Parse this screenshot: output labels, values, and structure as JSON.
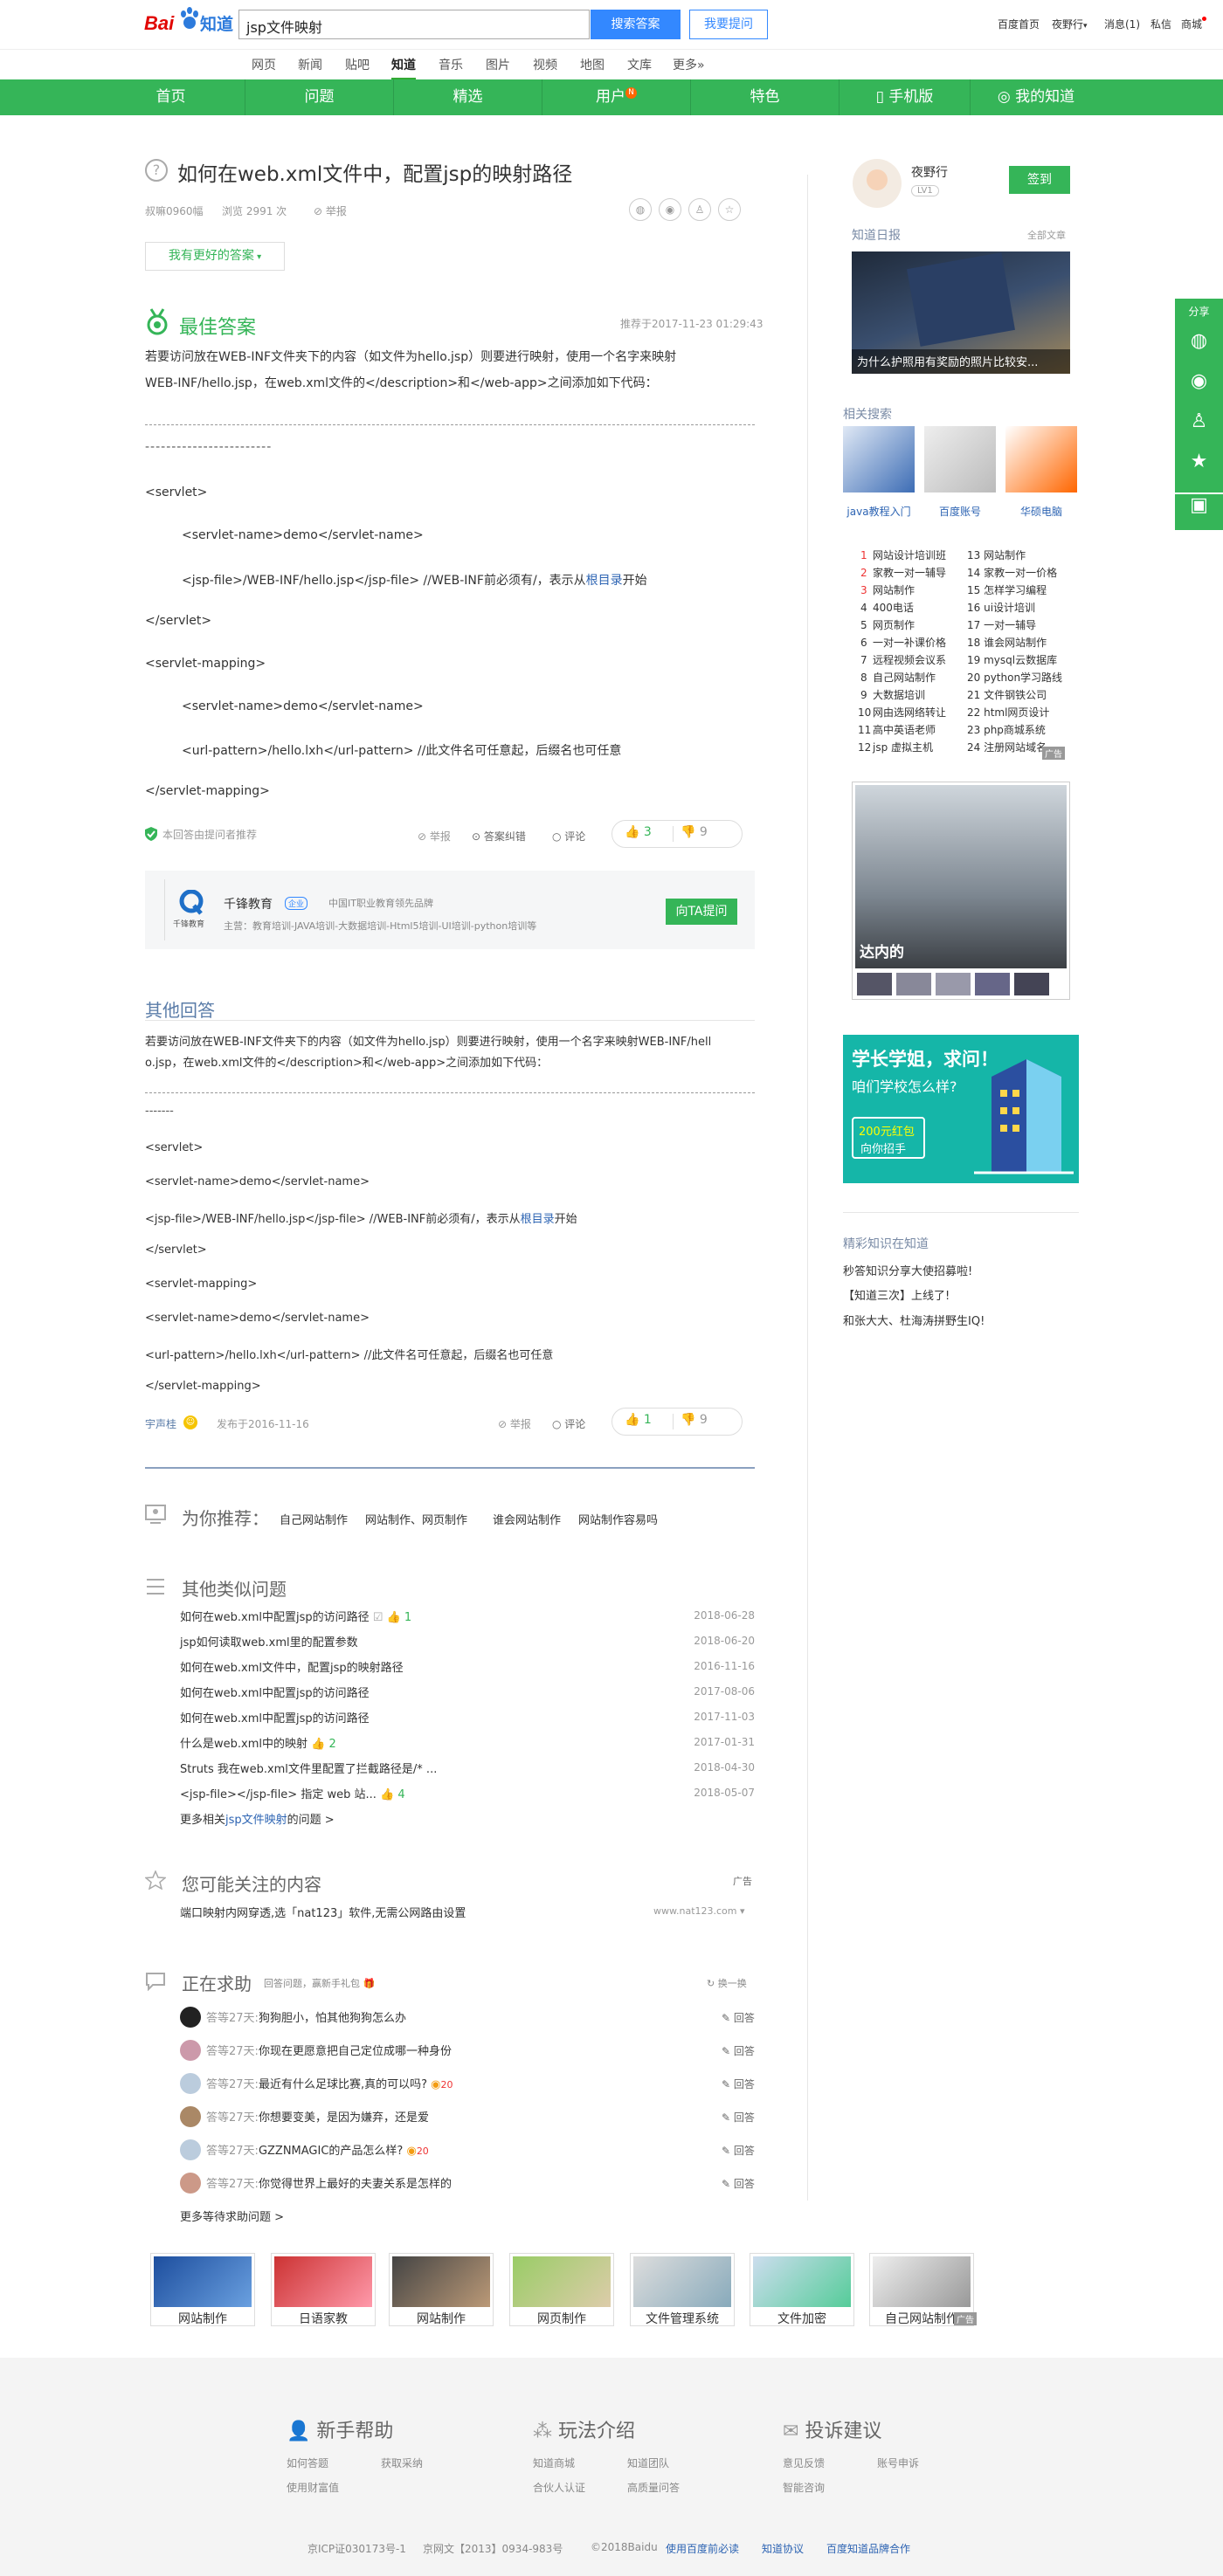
{
  "header": {
    "logo_text_a": "Bai",
    "logo_text_b": "知道",
    "search_value": "jsp文件映射",
    "search_button": "搜索答案",
    "ask_button": "我要提问",
    "user_links": [
      "百度首页",
      "夜野行",
      "消息(1)",
      "私信",
      "商城"
    ]
  },
  "nav": {
    "items": [
      "网页",
      "新闻",
      "贴吧",
      "知道",
      "音乐",
      "图片",
      "视频",
      "地图",
      "文库",
      "更多»"
    ],
    "current": "知道"
  },
  "green_bar": {
    "items": [
      "首页",
      "问题",
      "精选",
      "用户",
      "特色",
      "手机版",
      "我的知道"
    ],
    "badge": "N"
  },
  "question": {
    "title": "如何在web.xml文件中，配置jsp的映射路径",
    "asker": "叔嘛0960幅",
    "views": "浏览 2991 次",
    "report": "举报",
    "better_answer_button": "我有更好的答案"
  },
  "best_answer": {
    "heading": "最佳答案",
    "time": "推荐于2017-11-23 01:29:43",
    "intro1": "若要访问放在WEB-INF文件夹下的内容（如文件为hello.jsp）则要进行映射，使用一个名字来映射",
    "intro2": "WEB-INF/hello.jsp，在web.xml文件的</description>和</web-app>之间添加如下代码：",
    "dash_tail": "------------------------",
    "code": [
      "<servlet>",
      "<servlet-name>demo</servlet-name>",
      "<jsp-file>/WEB-INF/hello.jsp</jsp-file>   //WEB-INF前必须有/，表示从",
      "</servlet>",
      "<servlet-mapping>",
      "<servlet-name>demo</servlet-name>",
      "<url-pattern>/hello.lxh</url-pattern>           //此文件名可任意起，后缀名也可任意",
      "</servlet-mapping>"
    ],
    "root_link": "根目录",
    "root_tail": "开始",
    "recommended_by": "本回答由提问者推荐",
    "report": "举报",
    "correction": "答案纠错",
    "comment": "评论",
    "up": "3",
    "down": "9"
  },
  "company": {
    "name": "千锋教育",
    "tag": "企业",
    "desc": "中国IT职业教育领先品牌",
    "main": "主营：教育培训-JAVA培训-大数据培训-Html5培训-UI培训-python培训等",
    "button": "向TA提问",
    "logo_text": "千锋教育"
  },
  "other_answer": {
    "heading": "其他回答",
    "intro1": "若要访问放在WEB-INF文件夹下的内容（如文件为hello.jsp）则要进行映射，使用一个名字来映射WEB-INF/hell",
    "intro2": "o.jsp，在web.xml文件的</description>和</web-app>之间添加如下代码：",
    "dash_tail": "-------",
    "code": [
      "<servlet>",
      "<servlet-name>demo</servlet-name>",
      "<jsp-file>/WEB-INF/hello.jsp</jsp-file> //WEB-INF前必须有/，表示从",
      "</servlet>",
      "<servlet-mapping>",
      "<servlet-name>demo</servlet-name>",
      "<url-pattern>/hello.lxh</url-pattern> //此文件名可任意起，后缀名也可任意",
      "</servlet-mapping>"
    ],
    "root_link": "根目录",
    "root_tail": "开始",
    "author": "宇声桂",
    "time": "发布于2016-11-16",
    "report": "举报",
    "comment": "评论",
    "up": "1",
    "down": "9"
  },
  "recommend": {
    "heading": "为你推荐：",
    "links": [
      "自己网站制作",
      "网站制作、网页制作",
      "谁会网站制作",
      "网站制作容易吗"
    ]
  },
  "similar": {
    "heading": "其他类似问题",
    "items": [
      {
        "q": "如何在web.xml中配置jsp的访问路径",
        "count": "1",
        "date": "2018-06-28"
      },
      {
        "q": "jsp如何读取web.xml里的配置参数",
        "count": "",
        "date": "2018-06-20"
      },
      {
        "q": "如何在web.xml文件中，配置jsp的映射路径",
        "count": "",
        "date": "2016-11-16"
      },
      {
        "q": "如何在web.xml中配置jsp的访问路径",
        "count": "",
        "date": "2017-08-06"
      },
      {
        "q": "如何在web.xml中配置jsp的访问路径",
        "count": "",
        "date": "2017-11-03"
      },
      {
        "q": "什么是web.xml中的映射",
        "count": "2",
        "date": "2017-01-31"
      },
      {
        "q": "Struts 我在web.xml文件里配置了拦截路径是/* ...",
        "count": "",
        "date": "2018-04-30"
      },
      {
        "q": "<jsp-file></jsp-file> 指定 web 站...",
        "count": "4",
        "date": "2018-05-07"
      }
    ],
    "more_prefix": "更多相关",
    "more_link": "jsp文件映射",
    "more_suffix": "的问题 >"
  },
  "interest": {
    "heading": "您可能关注的内容",
    "ad": "广告",
    "text": "端口映射内网穿透,选「nat123」软件,无需公网路由设置",
    "url": "www.nat123.com"
  },
  "help": {
    "heading": "正在求助",
    "sub": "回答问题，赢新手礼包",
    "refresh": "换一换",
    "answer_label": "回答",
    "items": [
      {
        "nick": "答等27天:",
        "q": "狗狗胆小，怕其他狗狗怎么办",
        "coin": ""
      },
      {
        "nick": "答等27天:",
        "q": "你现在更愿意把自己定位成哪一种身份",
        "coin": ""
      },
      {
        "nick": "答等27天:",
        "q": "最近有什么足球比赛,真的可以吗?",
        "coin": "20"
      },
      {
        "nick": "答等27天:",
        "q": "你想要变美，是因为嫌弃，还是爱",
        "coin": ""
      },
      {
        "nick": "答等27天:",
        "q": "GZZNMAGIC的产品怎么样?",
        "coin": "20"
      },
      {
        "nick": "答等27天:",
        "q": "你觉得世界上最好的夫妻关系是怎样的",
        "coin": ""
      }
    ],
    "more": "更多等待求助问题 >"
  },
  "thumbs": {
    "labels": [
      "网站制作",
      "日语家教",
      "网站制作",
      "网页制作",
      "文件管理系统",
      "文件加密",
      "自己网站制作"
    ],
    "ad": "广告"
  },
  "footer": {
    "cols": [
      {
        "title": "新手帮助",
        "links": [
          "如何答题",
          "获取采纳",
          "使用财富值"
        ]
      },
      {
        "title": "玩法介绍",
        "links": [
          "知道商城",
          "知道团队",
          "合伙人认证",
          "高质量问答"
        ]
      },
      {
        "title": "投诉建议",
        "links": [
          "意见反馈",
          "账号申诉",
          "智能咨询"
        ]
      }
    ],
    "bottom": [
      "京ICP证030173号-1",
      "京网文【2013】0934-983号",
      "©2018Baidu",
      "使用百度前必读",
      "知道协议",
      "百度知道品牌合作"
    ]
  },
  "sidebar": {
    "user": "夜野行",
    "level": "LV1",
    "sign_button": "签到",
    "daily_heading": "知道日报",
    "daily_all": "全部文章",
    "daily_caption": "为什么护照用有奖励的照片比较安...",
    "related_heading": "相关搜索",
    "related": [
      "java教程入门",
      "百度账号",
      "华硕电脑"
    ],
    "hot": [
      "网站设计培训班",
      "13 网站制作",
      "家教一对一辅导",
      "14 家教一对一价格",
      "网站制作",
      "15 怎样学习编程",
      "400电话",
      "16 ui设计培训",
      "网页制作",
      "17 一对一辅导",
      "一对一补课价格",
      "18 谁会网站制作",
      "远程视频会议系",
      "19 mysql云数据库",
      "自己网站制作",
      "20 python学习路线",
      "大数据培训",
      "21 文件钢铁公司",
      "网由选网络转让",
      "22 html网页设计",
      "高中英语老师",
      "23 php商城系统",
      "jsp 虚拟主机",
      "24 注册网站域名"
    ],
    "hot_ad": "广告",
    "ad_caption": "达内的",
    "promo_line1": "学长学姐，求问！",
    "promo_line2": "咱们学校怎么样?",
    "promo_red": "200元红包",
    "promo_join": "向你招手",
    "knowledge_heading": "精彩知识在知道",
    "knowledge": [
      "秒答知识分享大使招募啦!",
      "【知道三次】上线了!",
      "和张大大、杜海涛拼野生IQ!"
    ]
  },
  "share": {
    "label": "分享"
  },
  "colors": {
    "green": "#35b558",
    "blue": "#3388ff",
    "link": "#2d64b3"
  }
}
